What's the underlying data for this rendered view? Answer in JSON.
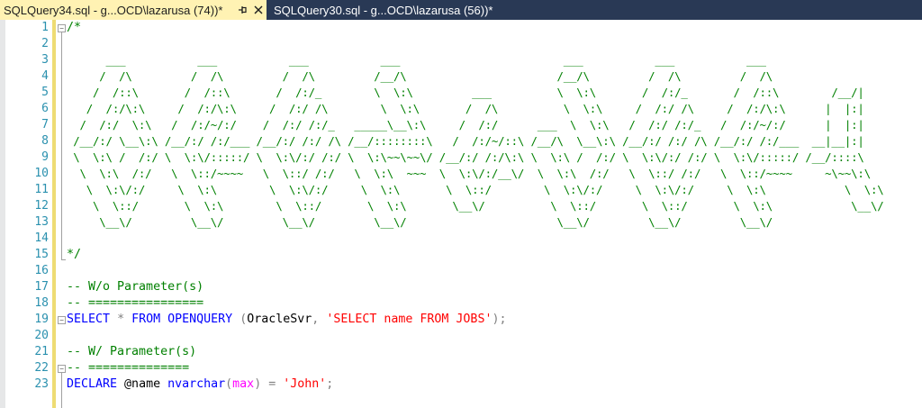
{
  "tabs": [
    {
      "title": "SQLQuery34.sql - g...OCD\\lazarusa (74))*",
      "active": true
    },
    {
      "title": "SQLQuery30.sql - g...OCD\\lazarusa (56))*",
      "active": false
    }
  ],
  "icons": {
    "pin": "pin-icon",
    "close": "close-icon"
  },
  "colors": {
    "tabbar_bg": "#293955",
    "active_tab_bg": "#fff2b3",
    "comment": "#008000",
    "keyword": "#0000ff",
    "string": "#ff0000",
    "line_number": "#2b91af"
  },
  "editor": {
    "lines": [
      {
        "num": "1",
        "text": "/*"
      },
      {
        "num": "2",
        "text": ""
      },
      {
        "num": "3",
        "art": "      ___           ___           ___           ___                         ___           ___           ___"
      },
      {
        "num": "4",
        "art": "     /  /\\         /  /\\         /  /\\         /__/\\                       /__/\\         /  /\\         /  /\\"
      },
      {
        "num": "5",
        "art": "    /  /::\\       /  /::\\       /  /:/_        \\  \\:\\         ___          \\  \\:\\       /  /:/_       /  /::\\        /__/|"
      },
      {
        "num": "6",
        "art": "   /  /:/\\:\\     /  /:/\\:\\     /  /:/ /\\        \\  \\:\\       /  /\\          \\  \\:\\     /  /:/ /\\     /  /:/\\:\\      |  |:|"
      },
      {
        "num": "7",
        "art": "  /  /:/  \\:\\   /  /:/~/:/    /  /:/ /:/_   _____\\__\\:\\     /  /:/      ___  \\  \\:\\   /  /:/ /:/_   /  /:/~/:/      |  |:|"
      },
      {
        "num": "8",
        "art": " /__/:/ \\__\\:\\ /__/:/ /:/___ /__/:/ /:/ /\\ /__/::::::::\\   /  /:/~/::\\ /__/\\  \\__\\:\\ /__/:/ /:/ /\\ /__/:/ /:/___  __|__|:|"
      },
      {
        "num": "9",
        "art": " \\  \\:\\ /  /:/ \\  \\:\\/:::::/ \\  \\:\\/:/ /:/ \\  \\:\\~~\\~~\\/ /__/:/ /:/\\:\\ \\  \\:\\ /  /:/ \\  \\:\\/:/ /:/ \\  \\:\\/:::::/ /__/::::\\"
      },
      {
        "num": "10",
        "art": "  \\  \\:\\  /:/   \\  \\::/~~~~   \\  \\::/ /:/   \\  \\:\\  ~~~  \\  \\:\\/:/__\\/  \\  \\:\\  /:/   \\  \\::/ /:/   \\  \\::/~~~~     ~\\~~\\:\\"
      },
      {
        "num": "11",
        "art": "   \\  \\:\\/:/     \\  \\:\\        \\  \\:\\/:/     \\  \\:\\       \\  \\::/        \\  \\:\\/:/     \\  \\:\\/:/     \\  \\:\\            \\  \\:\\"
      },
      {
        "num": "12",
        "art": "    \\  \\::/       \\  \\:\\        \\  \\::/       \\  \\:\\       \\__\\/          \\  \\::/       \\  \\::/       \\  \\:\\            \\__\\/"
      },
      {
        "num": "13",
        "art": "     \\__\\/         \\__\\/         \\__\\/         \\__\\/                       \\__\\/         \\__\\/         \\__\\/"
      },
      {
        "num": "14",
        "text": ""
      },
      {
        "num": "15",
        "text": "*/"
      },
      {
        "num": "16",
        "text": ""
      },
      {
        "num": "17",
        "text": "-- W/o Parameter(s)"
      },
      {
        "num": "18",
        "text": "-- ================"
      },
      {
        "num": "19",
        "tokens": [
          {
            "t": "SELECT",
            "c": "kw"
          },
          {
            "t": " ",
            "c": "plain"
          },
          {
            "t": "*",
            "c": "gray"
          },
          {
            "t": " ",
            "c": "plain"
          },
          {
            "t": "FROM",
            "c": "kw"
          },
          {
            "t": " ",
            "c": "plain"
          },
          {
            "t": "OPENQUERY",
            "c": "kw"
          },
          {
            "t": " ",
            "c": "plain"
          },
          {
            "t": "(",
            "c": "gray"
          },
          {
            "t": "OracleSvr",
            "c": "plain"
          },
          {
            "t": ",",
            "c": "gray"
          },
          {
            "t": " ",
            "c": "plain"
          },
          {
            "t": "'SELECT name FROM JOBS'",
            "c": "str"
          },
          {
            "t": ");",
            "c": "gray"
          }
        ]
      },
      {
        "num": "20",
        "text": ""
      },
      {
        "num": "21",
        "text": "-- W/ Parameter(s)"
      },
      {
        "num": "22",
        "text": "-- =============="
      },
      {
        "num": "23",
        "tokens": [
          {
            "t": "DECLARE",
            "c": "kw"
          },
          {
            "t": " @name ",
            "c": "plain"
          },
          {
            "t": "nvarchar",
            "c": "kw"
          },
          {
            "t": "(",
            "c": "gray"
          },
          {
            "t": "max",
            "c": "fn"
          },
          {
            "t": ")",
            "c": "gray"
          },
          {
            "t": " ",
            "c": "plain"
          },
          {
            "t": "=",
            "c": "gray"
          },
          {
            "t": " ",
            "c": "plain"
          },
          {
            "t": "'John'",
            "c": "str"
          },
          {
            "t": ";",
            "c": "gray"
          }
        ]
      }
    ]
  }
}
